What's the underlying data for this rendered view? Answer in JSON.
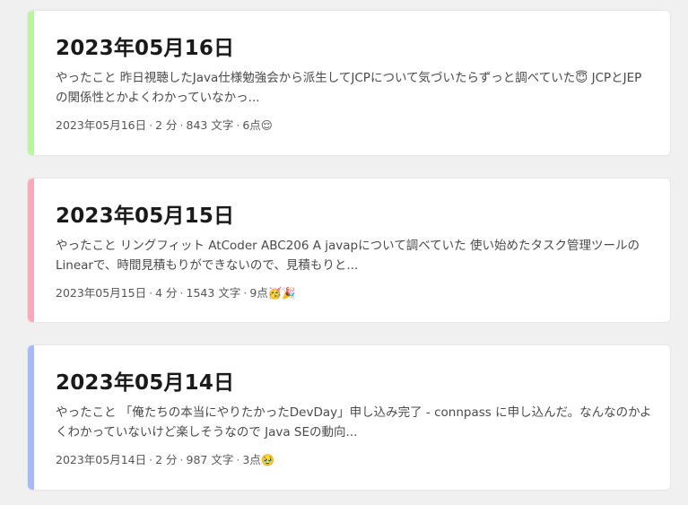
{
  "colors": {
    "background": "#f0f0f0",
    "card": "#ffffff"
  },
  "posts": [
    {
      "title": "2023年05月16日",
      "summary": "やったこと 昨日視聴したJava仕様勉強会から派生してJCPについて気づいたらずっと調べていた😇 JCPとJEPの関係性とかよくわかっていなかっ...",
      "date": "2023年05月16日",
      "read_time": "2 分",
      "chars": "843 文字",
      "score": "6点😌",
      "accent": "#b8f7a0"
    },
    {
      "title": "2023年05月15日",
      "summary": "やったこと リングフィット AtCoder ABC206 A javapについて調べていた 使い始めたタスク管理ツールのLinearで、時間見積もりができないので、見積もりと...",
      "date": "2023年05月15日",
      "read_time": "4 分",
      "chars": "1543 文字",
      "score": "9点🥳🎉",
      "accent": "#ffa8b8"
    },
    {
      "title": "2023年05月14日",
      "summary": "やったこと 「俺たちの本当にやりたかったDevDay」申し込み完了 - connpass に申し込んだ。なんなのかよくわかっていないけど楽しそうなので Java SEの動向...",
      "date": "2023年05月14日",
      "read_time": "2 分",
      "chars": "987 文字",
      "score": "3点🥹",
      "accent": "#a6b8ff"
    }
  ]
}
